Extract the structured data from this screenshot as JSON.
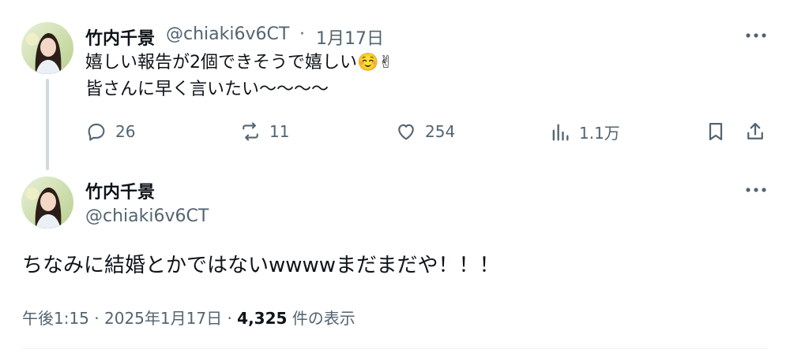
{
  "reply_tweet": {
    "author_name": "竹内千景",
    "author_handle": "@chiaki6v6CT",
    "separator": "·",
    "date": "1月17日",
    "text_line1": "嬉しい報告が2個できそうで嬉しい",
    "emoji1": "☺️",
    "emoji2": "✌",
    "text_line2": "皆さんに早く言いたい〜〜〜〜",
    "replies": "26",
    "reposts": "11",
    "likes": "254",
    "views": "1.1万"
  },
  "main_tweet": {
    "author_name": "竹内千景",
    "author_handle": "@chiaki6v6CT",
    "text": "ちなみに結婚とかではないwwwwまだまだや！！！",
    "time": "午後1:15",
    "separator1": "·",
    "date": "2025年1月17日",
    "separator2": "·",
    "view_count": "4,325",
    "view_label": "件の表示"
  },
  "icons": {
    "more": "more-horizontal-icon",
    "reply": "reply-icon",
    "repost": "repost-icon",
    "like": "heart-icon",
    "views": "views-bar-chart-icon",
    "bookmark": "bookmark-icon",
    "share": "share-icon"
  },
  "colors": {
    "text": "#0f1419",
    "secondary": "#536471",
    "thread_line": "#cfd9de"
  }
}
